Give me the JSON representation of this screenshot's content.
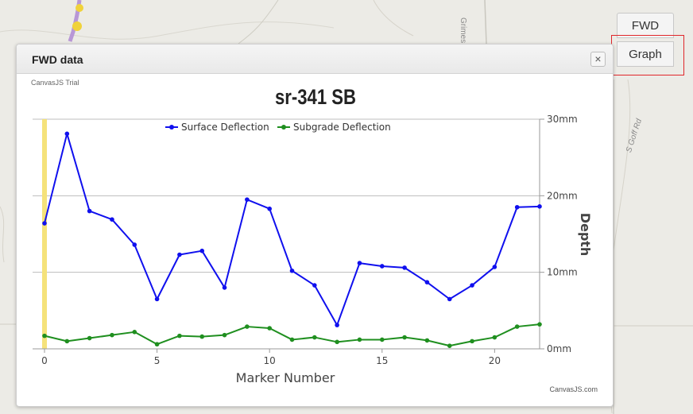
{
  "map": {
    "road_labels": [
      "Grimes Rd",
      "S Goff Rd"
    ]
  },
  "side_tabs": {
    "fwd_label": "FWD",
    "graph_label": "Graph"
  },
  "dialog": {
    "title": "FWD data",
    "close_symbol": "×",
    "close_icon": "close-icon"
  },
  "colors": {
    "surface": "#1010ee",
    "subgrade": "#1f8f1f",
    "highlight": "#f5e27a",
    "annotation": "#e0262b"
  },
  "chart_data": {
    "type": "line",
    "title": "sr-341 SB",
    "watermark": "CanvasJS Trial",
    "credit": "CanvasJS.com",
    "xlabel": "Marker Number",
    "ylabel": "Depth",
    "y_axis_side": "right",
    "ylim": [
      0,
      30
    ],
    "yticks": [
      0,
      10,
      20,
      30
    ],
    "ytick_labels": [
      "0mm",
      "10mm",
      "20mm",
      "30mm"
    ],
    "xlim": [
      0,
      22
    ],
    "xticks": [
      0,
      5,
      10,
      15,
      20
    ],
    "xtick_labels": [
      "0",
      "5",
      "10",
      "15",
      "20"
    ],
    "grid": true,
    "legend_position": "top-center",
    "highlight_marker": 0,
    "x": [
      0,
      1,
      2,
      3,
      4,
      5,
      6,
      7,
      8,
      9,
      10,
      11,
      12,
      13,
      14,
      15,
      16,
      17,
      18,
      19,
      20,
      21,
      22
    ],
    "series": [
      {
        "name": "Surface Deflection",
        "values": [
          16.4,
          28.1,
          18.0,
          16.9,
          13.6,
          6.5,
          12.3,
          12.8,
          8.0,
          19.5,
          18.3,
          10.2,
          8.3,
          3.1,
          11.2,
          10.8,
          10.6,
          8.7,
          6.5,
          8.3,
          10.7,
          18.5,
          18.6
        ]
      },
      {
        "name": "Subgrade Deflection",
        "values": [
          1.7,
          1.0,
          1.4,
          1.8,
          2.2,
          0.6,
          1.7,
          1.6,
          1.8,
          2.9,
          2.7,
          1.2,
          1.5,
          0.9,
          1.2,
          1.2,
          1.5,
          1.1,
          0.4,
          1.0,
          1.5,
          2.9,
          3.2
        ]
      }
    ]
  }
}
